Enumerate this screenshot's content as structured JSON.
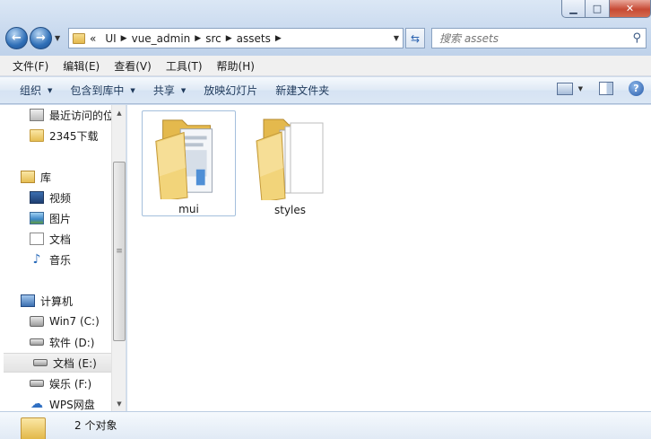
{
  "window": {
    "min_glyph": "▁",
    "max_glyph": "□",
    "close_glyph": "✕"
  },
  "navigation": {
    "back_glyph": "←",
    "forward_glyph": "→",
    "history_glyph": "▼"
  },
  "address_bar": {
    "overflow": "«",
    "crumbs": [
      "UI",
      "vue_admin",
      "src",
      "assets"
    ],
    "separator": "▶",
    "dropdown_glyph": "▼",
    "refresh_glyph": "⇆"
  },
  "search": {
    "placeholder": "搜索 assets",
    "icon": "search-icon",
    "glyph": "⚲"
  },
  "menu": [
    "文件(F)",
    "编辑(E)",
    "查看(V)",
    "工具(T)",
    "帮助(H)"
  ],
  "toolbar": {
    "organize": "组织",
    "include_in_library": "包含到库中",
    "share": "共享",
    "slideshow": "放映幻灯片",
    "new_folder": "新建文件夹",
    "dropdown_glyph": "▼",
    "help_glyph": "?"
  },
  "nav_pane": {
    "items": [
      {
        "label": "最近访问的位置",
        "icon": "recent-places-icon"
      },
      {
        "label": "2345下载",
        "icon": "folder-icon"
      },
      {
        "label": "库",
        "icon": "library-icon"
      },
      {
        "label": "视频",
        "icon": "video-icon"
      },
      {
        "label": "图片",
        "icon": "picture-icon"
      },
      {
        "label": "文档",
        "icon": "document-icon"
      },
      {
        "label": "音乐",
        "icon": "music-icon",
        "glyph": "♪"
      },
      {
        "label": "计算机",
        "icon": "computer-icon"
      },
      {
        "label": "Win7 (C:)",
        "icon": "windows-drive-icon"
      },
      {
        "label": "软件 (D:)",
        "icon": "drive-icon"
      },
      {
        "label": "文档 (E:)",
        "icon": "drive-icon",
        "selected": true
      },
      {
        "label": "娱乐 (F:)",
        "icon": "drive-icon"
      },
      {
        "label": "WPS网盘",
        "icon": "cloud-icon",
        "glyph": "☁"
      }
    ],
    "scroll_up_glyph": "▲",
    "scroll_down_glyph": "▼",
    "thumb_grip": "≡"
  },
  "files": [
    {
      "name": "mui",
      "selected": true
    },
    {
      "name": "styles",
      "selected": false
    }
  ],
  "status": {
    "text": "2 个对象"
  }
}
